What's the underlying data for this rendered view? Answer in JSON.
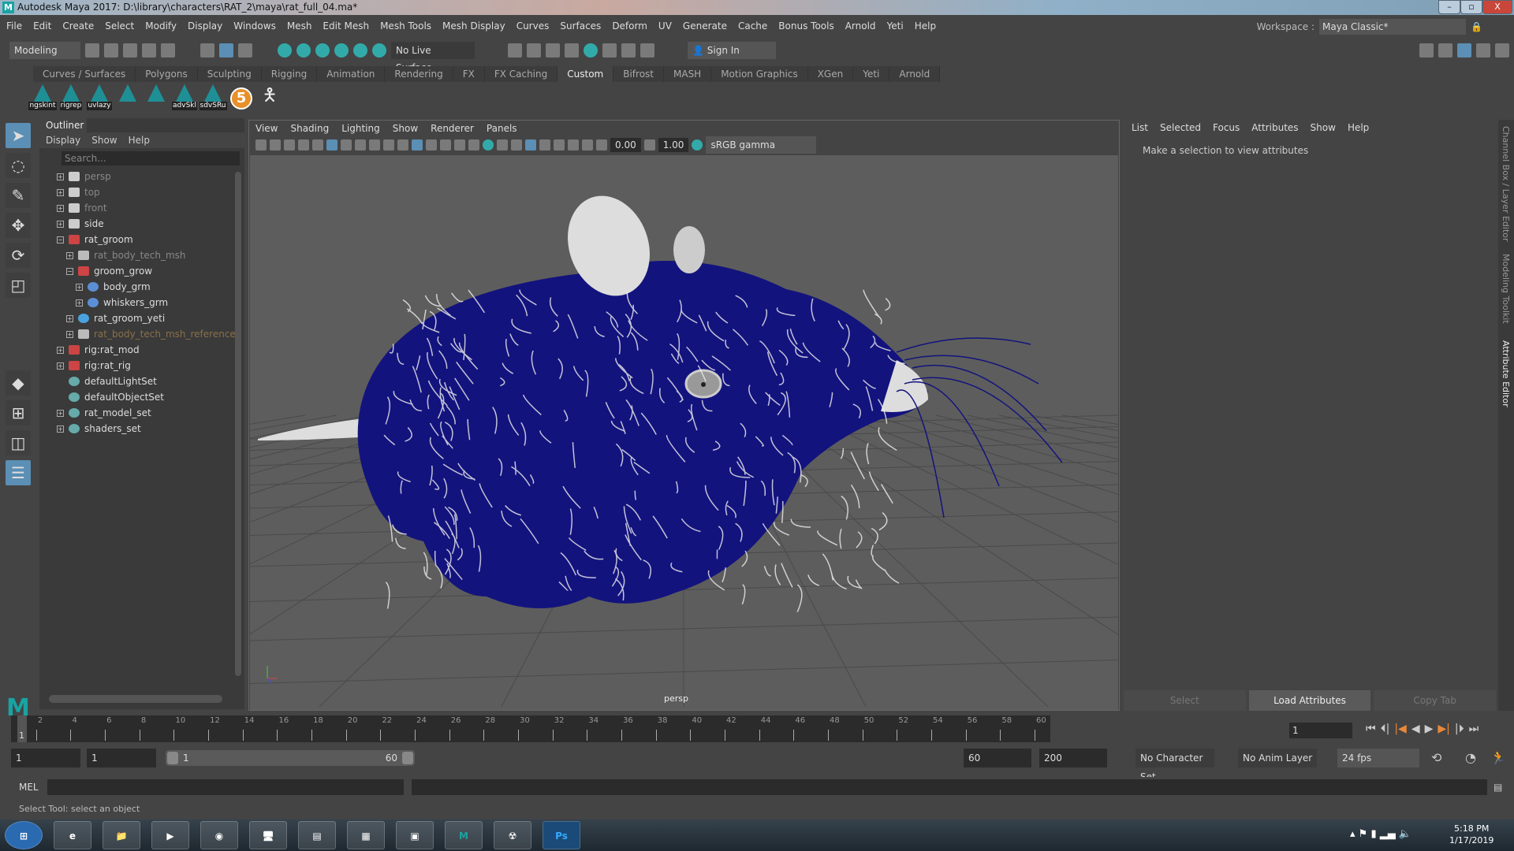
{
  "window": {
    "title": "Autodesk Maya 2017: D:\\library\\characters\\RAT_2\\maya\\rat_full_04.ma*",
    "minimize": "–",
    "restore": "▫",
    "close": "X"
  },
  "menubar": [
    "File",
    "Edit",
    "Create",
    "Select",
    "Modify",
    "Display",
    "Windows",
    "Mesh",
    "Edit Mesh",
    "Mesh Tools",
    "Mesh Display",
    "Curves",
    "Surfaces",
    "Deform",
    "UV",
    "Generate",
    "Cache",
    "Bonus Tools",
    "Arnold",
    "Yeti",
    "Help"
  ],
  "workspace": {
    "label": "Workspace :",
    "value": "Maya Classic*"
  },
  "statusline": {
    "menu_set": "Modeling",
    "live_surface": "No Live Surface",
    "sign_in": "Sign In"
  },
  "shelf": {
    "tabs": [
      "Curves / Surfaces",
      "Polygons",
      "Sculpting",
      "Rigging",
      "Animation",
      "Rendering",
      "FX",
      "FX Caching",
      "Custom",
      "Bifrost",
      "MASH",
      "Motion Graphics",
      "XGen",
      "Yeti",
      "Arnold"
    ],
    "active_tab": "Custom",
    "buttons": [
      "ngskint",
      "rigrep",
      "uvlazy",
      "",
      "",
      "advSkl",
      "sdvSRu"
    ],
    "badge": "5"
  },
  "outliner": {
    "title": "Outliner",
    "menu": [
      "Display",
      "Show",
      "Help"
    ],
    "search_placeholder": "Search...",
    "items": [
      {
        "label": "persp",
        "indent": 0,
        "type": "camera",
        "style": "dim",
        "toggle": "+"
      },
      {
        "label": "top",
        "indent": 0,
        "type": "camera",
        "style": "dim",
        "toggle": "+"
      },
      {
        "label": "front",
        "indent": 0,
        "type": "camera",
        "style": "dim",
        "toggle": "+"
      },
      {
        "label": "side",
        "indent": 0,
        "type": "camera",
        "style": "",
        "toggle": "+"
      },
      {
        "label": "rat_groom",
        "indent": 0,
        "type": "group",
        "style": "",
        "toggle": "−"
      },
      {
        "label": "rat_body_tech_msh",
        "indent": 1,
        "type": "mesh",
        "style": "dim",
        "toggle": "+"
      },
      {
        "label": "groom_grow",
        "indent": 1,
        "type": "group",
        "style": "",
        "toggle": "−"
      },
      {
        "label": "body_grm",
        "indent": 2,
        "type": "groom",
        "style": "",
        "toggle": "+"
      },
      {
        "label": "whiskers_grm",
        "indent": 2,
        "type": "groom",
        "style": "",
        "toggle": "+"
      },
      {
        "label": "rat_groom_yeti",
        "indent": 1,
        "type": "yeti",
        "style": "",
        "toggle": "+"
      },
      {
        "label": "rat_body_tech_msh_reference",
        "indent": 1,
        "type": "mesh",
        "style": "ref",
        "toggle": "+"
      },
      {
        "label": "rig:rat_mod",
        "indent": 0,
        "type": "group",
        "style": "",
        "toggle": "+"
      },
      {
        "label": "rig:rat_rig",
        "indent": 0,
        "type": "group",
        "style": "",
        "toggle": "+"
      },
      {
        "label": "defaultLightSet",
        "indent": 0,
        "type": "set",
        "style": "",
        "toggle": ""
      },
      {
        "label": "defaultObjectSet",
        "indent": 0,
        "type": "set",
        "style": "",
        "toggle": ""
      },
      {
        "label": "rat_model_set",
        "indent": 0,
        "type": "set",
        "style": "",
        "toggle": "+"
      },
      {
        "label": "shaders_set",
        "indent": 0,
        "type": "set",
        "style": "",
        "toggle": "+"
      }
    ]
  },
  "viewport": {
    "menu": [
      "View",
      "Shading",
      "Lighting",
      "Show",
      "Renderer",
      "Panels"
    ],
    "exposure": "0.00",
    "gamma": "1.00",
    "color_space": "sRGB gamma",
    "camera_label": "persp",
    "fur_color": "#13137e"
  },
  "attribute_editor": {
    "menu": [
      "List",
      "Selected",
      "Focus",
      "Attributes",
      "Show",
      "Help"
    ],
    "message": "Make a selection to view attributes",
    "buttons": [
      "Select",
      "Load Attributes",
      "Copy Tab"
    ]
  },
  "side_tabs": [
    "Channel Box / Layer Editor",
    "Modeling Toolkit",
    "Attribute Editor"
  ],
  "timeline": {
    "start": 1,
    "end": 60,
    "current": "1",
    "ticks": [
      2,
      4,
      6,
      8,
      10,
      12,
      14,
      16,
      18,
      20,
      22,
      24,
      26,
      28,
      30,
      32,
      34,
      36,
      38,
      40,
      42,
      44,
      46,
      48,
      50,
      52,
      54,
      56,
      58,
      60
    ]
  },
  "range": {
    "start": "1",
    "anim_start": "1",
    "range_start": "1",
    "range_end": "60",
    "end": "60",
    "anim_end": "200",
    "character_set": "No Character Set",
    "anim_layer": "No Anim Layer",
    "fps": "24 fps"
  },
  "command_line": {
    "label": "MEL"
  },
  "status_message": "Select Tool: select an object",
  "taskbar": {
    "time": "5:18 PM",
    "date": "1/17/2019",
    "apps": [
      "start",
      "internet-explorer",
      "file-explorer",
      "media-player",
      "chrome",
      "remote-desktop",
      "notepad",
      "calculator",
      "photo-viewer",
      "maya",
      "other-app",
      "photoshop"
    ]
  }
}
